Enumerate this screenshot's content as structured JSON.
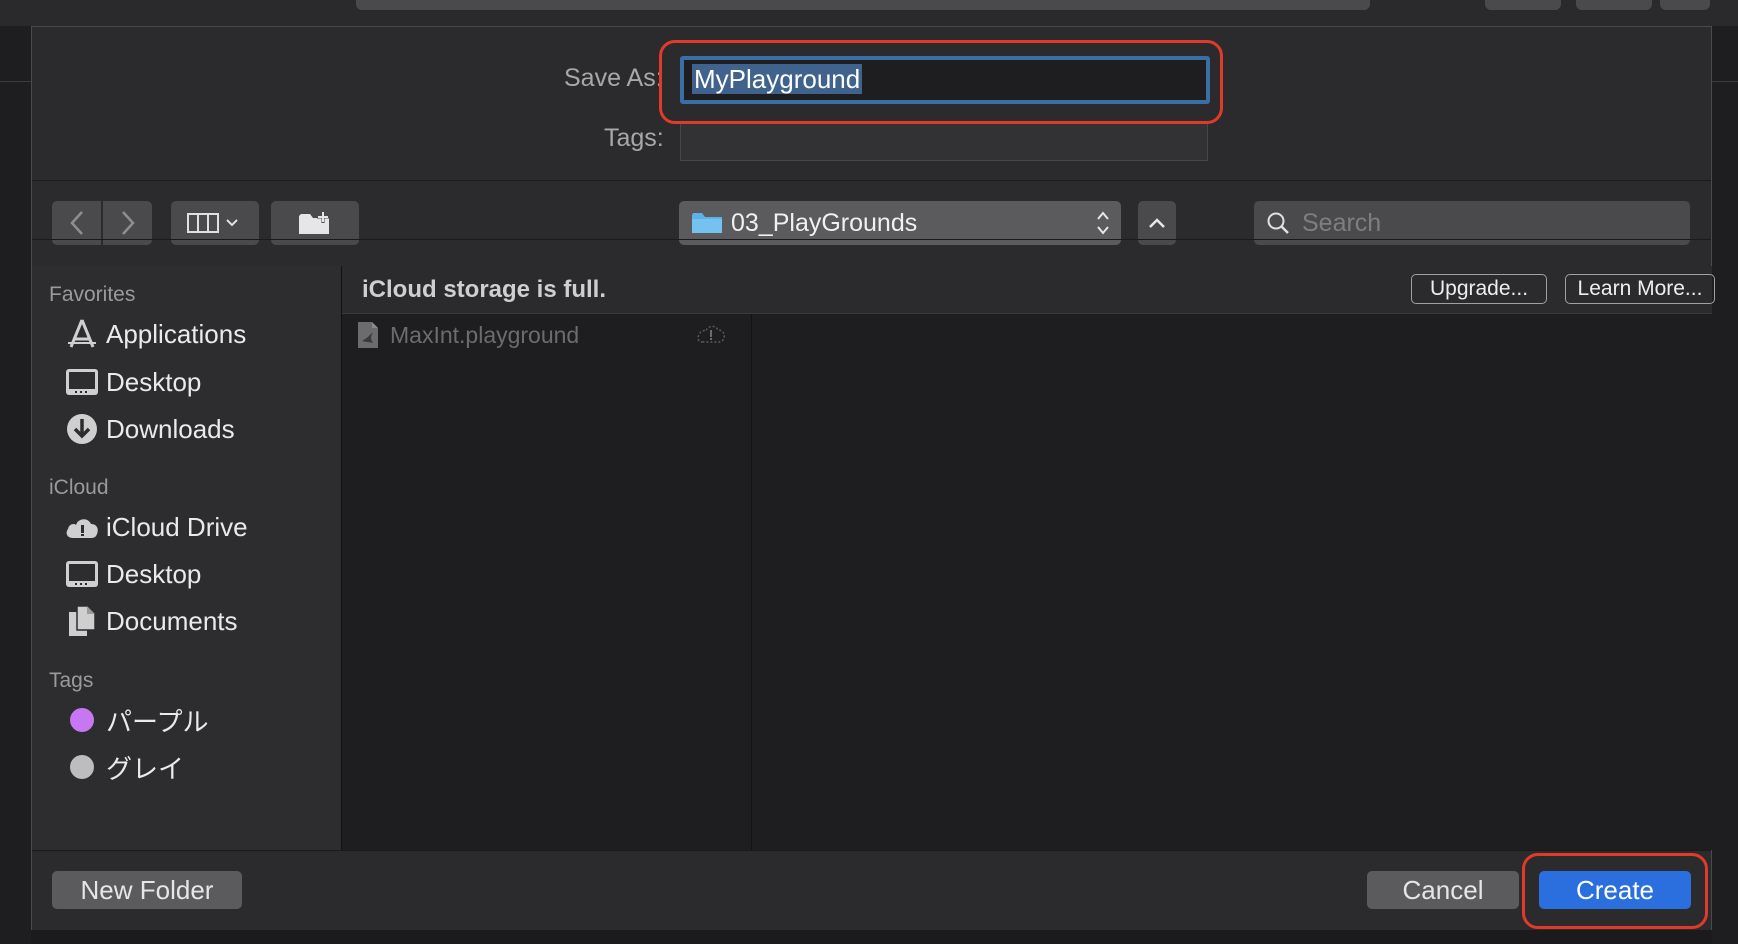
{
  "save_panel": {
    "save_as_label": "Save As:",
    "save_as_value": "MyPlayground",
    "tags_label": "Tags:"
  },
  "toolbar": {
    "back_icon": "chevron-left-icon",
    "forward_icon": "chevron-right-icon",
    "view_icon": "columns-view-icon",
    "new_folder_icon": "new-folder-icon",
    "location": "03_PlayGrounds",
    "search_placeholder": "Search"
  },
  "sidebar": {
    "sections": [
      {
        "title": "Favorites",
        "items": [
          {
            "label": "Applications",
            "icon": "applications-icon"
          },
          {
            "label": "Desktop",
            "icon": "desktop-icon"
          },
          {
            "label": "Downloads",
            "icon": "downloads-icon"
          }
        ]
      },
      {
        "title": "iCloud",
        "items": [
          {
            "label": "iCloud Drive",
            "icon": "icloud-icon"
          },
          {
            "label": "Desktop",
            "icon": "desktop-icon"
          },
          {
            "label": "Documents",
            "icon": "documents-icon"
          }
        ]
      },
      {
        "title": "Tags",
        "items": [
          {
            "label": "パープル",
            "icon": "tag-dot-icon",
            "color": "#c777f2"
          },
          {
            "label": "グレイ",
            "icon": "tag-dot-icon",
            "color": "#bdbdbd"
          }
        ]
      }
    ]
  },
  "banner": {
    "message": "iCloud storage is full.",
    "upgrade_label": "Upgrade...",
    "learn_more_label": "Learn More..."
  },
  "files": [
    {
      "name": "MaxInt.playground",
      "icon": "playground-file-icon",
      "status_icon": "cloud-warning-icon"
    }
  ],
  "bottom": {
    "new_folder_label": "New Folder",
    "cancel_label": "Cancel",
    "create_label": "Create"
  },
  "colors": {
    "accent": "#2b6fdf",
    "highlight_annotation": "#e03a2a",
    "selection": "#3f638c"
  }
}
